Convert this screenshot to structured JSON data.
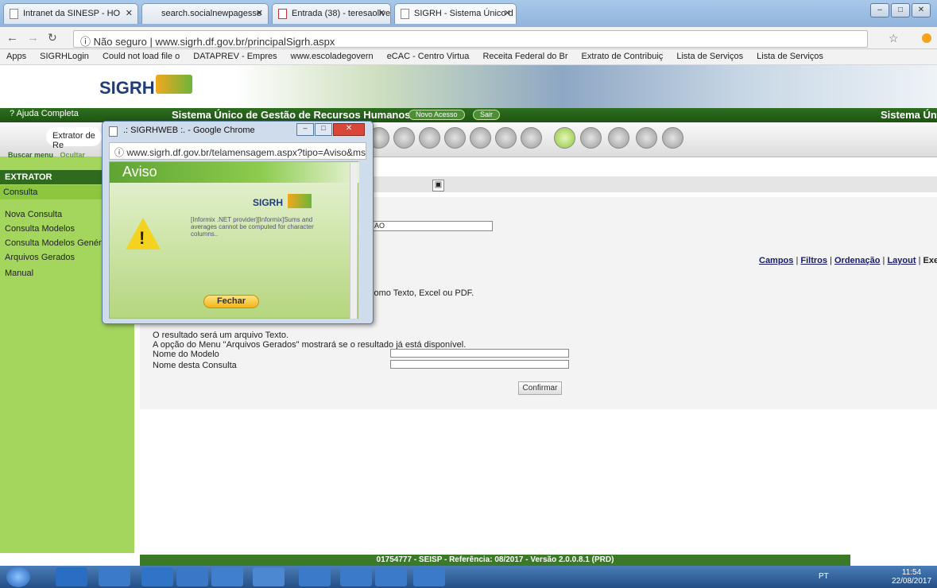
{
  "browser": {
    "tabs": [
      {
        "label": "Intranet da SINESP - HO"
      },
      {
        "label": "search.socialnewpagesse"
      },
      {
        "label": "Entrada (38) - teresaolive"
      },
      {
        "label": "SIGRH - Sistema Único d"
      }
    ],
    "url": "www.sigrh.df.gov.br/principalSigrh.aspx",
    "security_label": "Não seguro",
    "bookmarks": [
      "Apps",
      "SIGRHLogin",
      "Could not load file o",
      "DATAPREV - Empres",
      "www.escoladegovern",
      "eCAC - Centro Virtua",
      "Receita Federal do Br",
      "Extrato de Contribuiç",
      "Lista de Serviços",
      "Lista de Serviços"
    ]
  },
  "header": {
    "logo": "SIGRH",
    "system_title": "Sistema Único de Gestão de Recursos Humanos",
    "system_title_right": "Sistema Ún",
    "help_label": "Ajuda Completa",
    "novo_acesso": "Novo Acesso",
    "sair": "Sair",
    "extrator_tab": "Extrator de Re",
    "buscar_menu": "Buscar menu",
    "ocultar": "Ocultar"
  },
  "sidebar": {
    "section": "EXTRATOR",
    "subsection": "Consulta",
    "items": [
      {
        "label": "Nova Consulta"
      },
      {
        "label": "Consulta Modelos"
      },
      {
        "label": "Consulta Modelos Genéricos"
      },
      {
        "label": "Arquivos Gerados"
      }
    ],
    "manual": "Manual"
  },
  "main": {
    "input_value": "AO",
    "links": [
      "Campos",
      "Filtros",
      "Ordenação",
      "Layout",
      "Execução"
    ],
    "format_text": "como Texto, Excel ou PDF.",
    "result_text": "O resultado será um arquivo Texto.",
    "menu_hint": "A opção do Menu \"Arquivos Gerados\" mostrará se o resultado já está disponível.",
    "model_name_label": "Nome do Modelo",
    "query_name_label": "Nome desta Consulta",
    "confirm_label": "Confirmar",
    "footer": "01754777 - SEISP - Referência: 08/2017 - Versão 2.0.0.8.1 (PRD)"
  },
  "popup": {
    "window_title": ".: SIGRHWEB :. - Google Chrome",
    "url": "www.sigrh.df.gov.br/telamensagem.aspx?tipo=Aviso&msg=",
    "heading": "Aviso",
    "logo": "SIGRH",
    "message": "[Informix .NET provider][Informix]Sums and averages cannot be computed for character columns..",
    "close_label": "Fechar"
  },
  "taskbar": {
    "lang": "PT",
    "time": "11:54",
    "date": "22/08/2017"
  }
}
